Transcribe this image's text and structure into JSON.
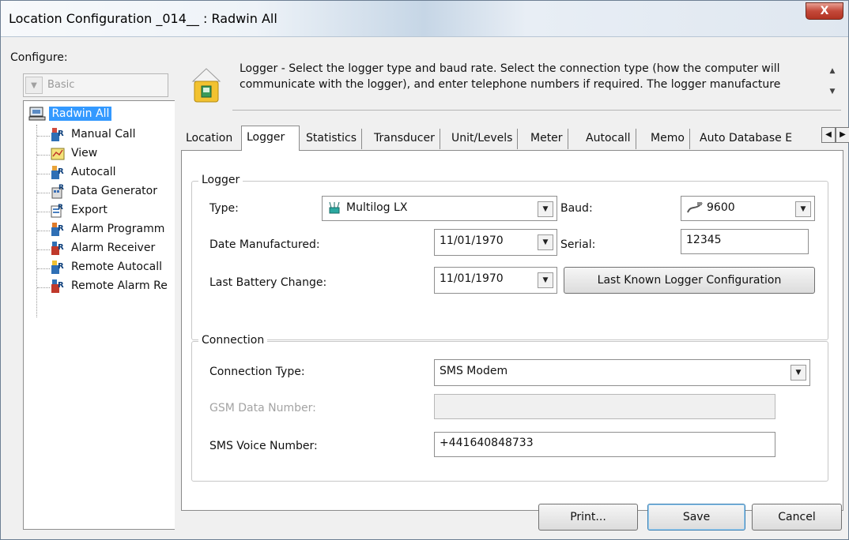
{
  "window": {
    "title": "Location Configuration _014__ : Radwin All",
    "close_glyph": "X"
  },
  "sidebar": {
    "configure_label": "Configure:",
    "mode_value": "Basic",
    "root": "Radwin All",
    "items": [
      {
        "label": "Manual Call",
        "icon": "manual-call-icon"
      },
      {
        "label": "View",
        "icon": "view-icon"
      },
      {
        "label": "Autocall",
        "icon": "autocall-icon"
      },
      {
        "label": "Data Generator",
        "icon": "data-generator-icon"
      },
      {
        "label": "Export",
        "icon": "export-icon"
      },
      {
        "label": "Alarm Programm",
        "icon": "alarm-programmer-icon"
      },
      {
        "label": "Alarm Receiver",
        "icon": "alarm-receiver-icon"
      },
      {
        "label": "Remote Autocall",
        "icon": "remote-autocall-icon"
      },
      {
        "label": "Remote Alarm Re",
        "icon": "remote-alarm-receiver-icon"
      }
    ]
  },
  "info": {
    "line1": "Logger - Select the logger type and baud rate. Select the connection type (how the computer will",
    "line2": "communicate with the logger), and enter telephone numbers if required. The logger manufacture"
  },
  "tabs": [
    {
      "label": "Location"
    },
    {
      "label": "Logger"
    },
    {
      "label": "Statistics"
    },
    {
      "label": "Transducer"
    },
    {
      "label": "Unit/Levels"
    },
    {
      "label": "Meter"
    },
    {
      "label": "Autocall"
    },
    {
      "label": "Memo"
    },
    {
      "label": "Auto Database E"
    }
  ],
  "logger": {
    "group_title": "Logger",
    "type_label": "Type:",
    "type_value": "Multilog LX",
    "baud_label": "Baud:",
    "baud_value": "9600",
    "date_label": "Date Manufactured:",
    "date_value": "11/01/1970",
    "serial_label": "Serial:",
    "serial_value": "12345",
    "battery_label": "Last Battery Change:",
    "battery_value": "11/01/1970",
    "last_known_button": "Last Known Logger Configuration"
  },
  "connection": {
    "group_title": "Connection",
    "type_label": "Connection Type:",
    "type_value": "SMS Modem",
    "gsm_label": "GSM Data Number:",
    "gsm_value": "",
    "sms_label": "SMS Voice Number:",
    "sms_value": "+441640848733"
  },
  "footer": {
    "print_label": "Print...",
    "save_label": "Save",
    "cancel_label": "Cancel"
  }
}
